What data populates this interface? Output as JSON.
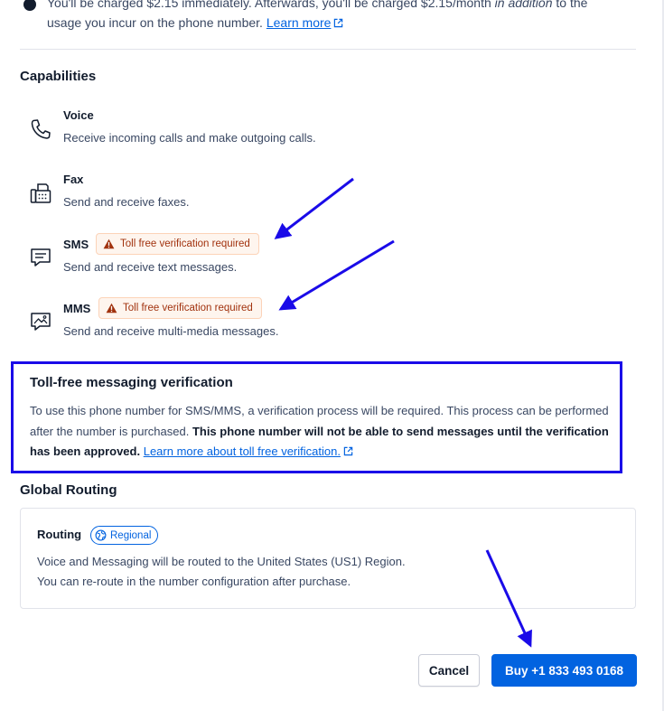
{
  "pricing_notice": {
    "line1_prefix": "You'll be charged $2.15 immediately. Afterwards, you'll be charged $2.15/month ",
    "line1_emphasis": "in addition",
    "line1_suffix": " to the",
    "line2_text": "usage you incur on the phone number. ",
    "learn_more": "Learn more"
  },
  "capabilities": {
    "title": "Capabilities",
    "items": [
      {
        "name": "Voice",
        "description": "Receive incoming calls and make outgoing calls.",
        "icon": "phone-icon"
      },
      {
        "name": "Fax",
        "description": "Send and receive faxes.",
        "icon": "fax-icon"
      },
      {
        "name": "SMS",
        "description": "Send and receive text messages.",
        "icon": "message-icon",
        "badge": "Toll free verification required"
      },
      {
        "name": "MMS",
        "description": "Send and receive multi-media messages.",
        "icon": "image-message-icon",
        "badge": "Toll free verification required"
      }
    ]
  },
  "verification": {
    "title": "Toll-free messaging verification",
    "body_plain": "To use this phone number for SMS/MMS, a verification process will be required. This process can be performed after the number is purchased. ",
    "body_bold": "This phone number will not be able to send messages until the verification has been approved.",
    "link": "Learn more about toll free verification."
  },
  "routing": {
    "section_title": "Global Routing",
    "label": "Routing",
    "badge": "Regional",
    "line1": "Voice and Messaging will be routed to the United States (US1) Region.",
    "line2": "You can re-route in the number configuration after purchase."
  },
  "actions": {
    "cancel": "Cancel",
    "buy": "Buy +1 833 493 0168"
  },
  "colors": {
    "primary": "#0263e0",
    "warning_text": "#a1320e",
    "warning_bg": "#fef5ee",
    "annotation": "#1a0be8"
  }
}
